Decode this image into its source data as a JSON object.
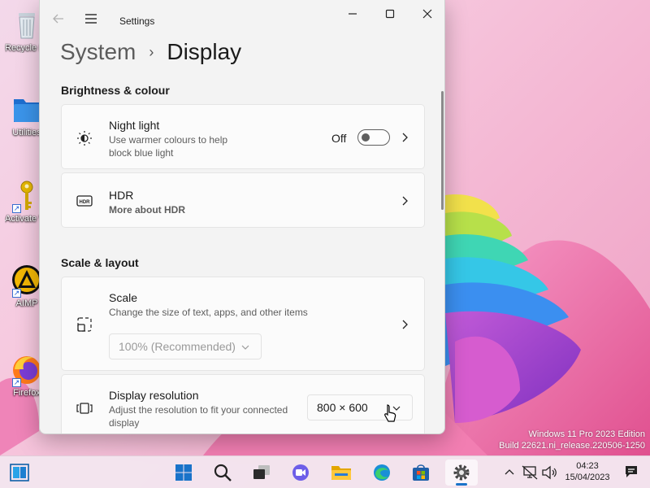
{
  "desktop": {
    "icons": [
      {
        "label": "Recycle Bin"
      },
      {
        "label": "Utilities"
      },
      {
        "label": "Activate Windows"
      },
      {
        "label": "AIMP"
      },
      {
        "label": "Firefox"
      }
    ]
  },
  "window": {
    "title": "Settings",
    "breadcrumb_parent": "System",
    "breadcrumb_current": "Display",
    "sections": {
      "brightness": "Brightness & colour",
      "scale_layout": "Scale & layout"
    },
    "night_light": {
      "title": "Night light",
      "description": "Use warmer colours to help block blue light",
      "state_label": "Off",
      "enabled": false
    },
    "hdr": {
      "title": "HDR",
      "link": "More about HDR"
    },
    "scale": {
      "title": "Scale",
      "description": "Change the size of text, apps, and other items",
      "value": "100% (Recommended)"
    },
    "resolution": {
      "title": "Display resolution",
      "description": "Adjust the resolution to fit your connected display",
      "value": "800 × 600"
    }
  },
  "watermark": {
    "line1": "Windows 11 Pro 2023 Edition",
    "line2": "Build 22621.ni_release.220506-1250"
  },
  "taskbar": {
    "apps": [
      "start",
      "search",
      "task-view",
      "chat",
      "file-explorer",
      "edge",
      "microsoft-store",
      "settings"
    ],
    "active_app": "settings",
    "clock_time": "04:23",
    "clock_date": "15/04/2023"
  },
  "colors": {
    "accent": "#1a73c9",
    "link": "#0e4a2d",
    "window_bg": "#f3f3f3"
  }
}
